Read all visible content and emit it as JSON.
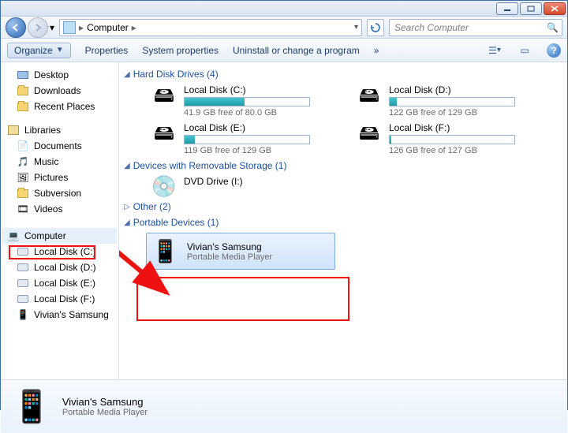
{
  "titlebar": {},
  "nav": {
    "path_crumbs": [
      "Computer"
    ],
    "search_placeholder": "Search Computer"
  },
  "toolbar": {
    "organize": "Organize",
    "items": [
      "Properties",
      "System properties",
      "Uninstall or change a program"
    ],
    "more": "»"
  },
  "sidebar": {
    "top": [
      {
        "icon": "desktop",
        "label": "Desktop"
      },
      {
        "icon": "downloads",
        "label": "Downloads"
      },
      {
        "icon": "recent",
        "label": "Recent Places"
      }
    ],
    "libraries_label": "Libraries",
    "libraries": [
      {
        "icon": "documents",
        "label": "Documents"
      },
      {
        "icon": "music",
        "label": "Music"
      },
      {
        "icon": "pictures",
        "label": "Pictures"
      },
      {
        "icon": "folder",
        "label": "Subversion"
      },
      {
        "icon": "videos",
        "label": "Videos"
      }
    ],
    "computer_label": "Computer",
    "computer_children": [
      {
        "label": "Local Disk (C:)"
      },
      {
        "label": "Local Disk (D:)"
      },
      {
        "label": "Local Disk (E:)"
      },
      {
        "label": "Local Disk (F:)"
      },
      {
        "label": "Vivian's Samsung"
      }
    ]
  },
  "content": {
    "hdd_header": "Hard Disk Drives (4)",
    "hdd": [
      {
        "name": "Local Disk (C:)",
        "free": "41.9 GB free of 80.0 GB",
        "pct": 48
      },
      {
        "name": "Local Disk (D:)",
        "free": "122 GB free of 129 GB",
        "pct": 6
      },
      {
        "name": "Local Disk (E:)",
        "free": "119 GB free of 129 GB",
        "pct": 8
      },
      {
        "name": "Local Disk (F:)",
        "free": "126 GB free of 127 GB",
        "pct": 1
      }
    ],
    "removable_header": "Devices with Removable Storage (1)",
    "removable": [
      {
        "name": "DVD Drive (I:)"
      }
    ],
    "other_header": "Other (2)",
    "portable_header": "Portable Devices (1)",
    "portable": [
      {
        "name": "Vivian's Samsung",
        "sub": "Portable Media Player"
      }
    ]
  },
  "details": {
    "title": "Vivian's Samsung",
    "subtitle": "Portable Media Player"
  }
}
